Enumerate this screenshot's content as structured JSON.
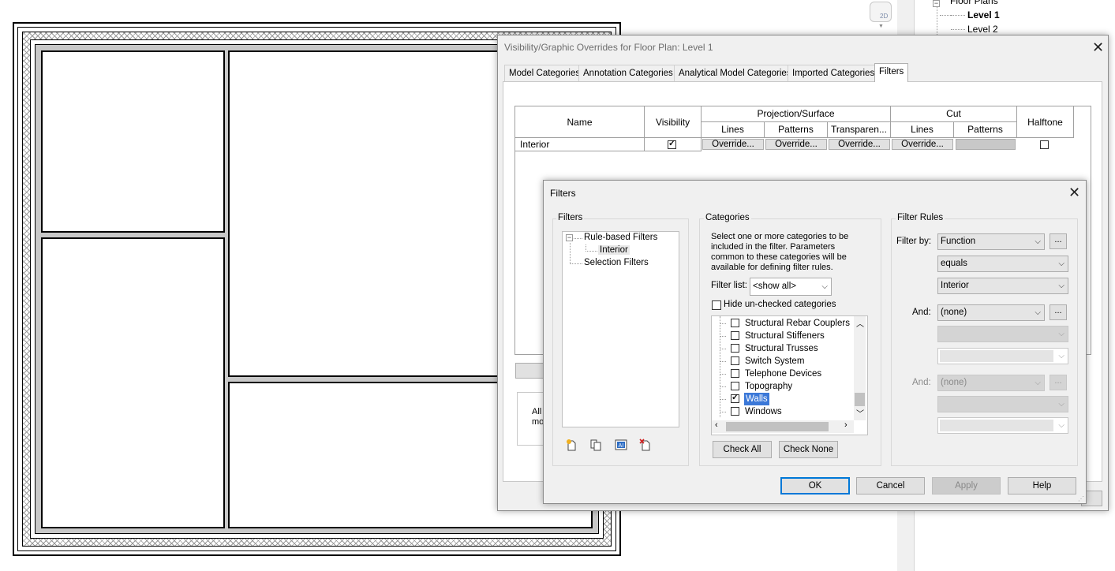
{
  "project_browser": {
    "floor_plans": "Floor Plans",
    "level1": "Level 1",
    "level2": "Level 2",
    "view_cube": "2D"
  },
  "vg_dialog": {
    "title": "Visibility/Graphic Overrides for Floor Plan: Level 1",
    "tabs": [
      "Model Categories",
      "Annotation Categories",
      "Analytical Model Categories",
      "Imported Categories",
      "Filters"
    ],
    "active_tab": "Filters",
    "headers": {
      "name": "Name",
      "visibility": "Visibility",
      "projection": "Projection/Surface",
      "cut": "Cut",
      "halftone": "Halftone",
      "lines": "Lines",
      "patterns": "Patterns",
      "transparency": "Transparen...",
      "cut_lines": "Lines",
      "cut_patterns": "Patterns"
    },
    "row": {
      "name": "Interior",
      "visible": true,
      "override": "Override...",
      "halftone": false
    },
    "partial_text": [
      "All",
      "mo"
    ]
  },
  "filters_dialog": {
    "title": "Filters",
    "filters_group": "Filters",
    "tree": {
      "rule_based": "Rule-based Filters",
      "interior": "Interior",
      "selection": "Selection Filters"
    },
    "categories_group": "Categories",
    "categories_desc": [
      "Select one or more categories to be",
      "included in the filter.  Parameters",
      "common to these categories will be",
      "available for defining filter rules."
    ],
    "filter_list_label": "Filter list:",
    "filter_list_value": "<show all>",
    "hide_unchecked": "Hide un-checked categories",
    "categories": [
      {
        "label": "Structural Rebar Couplers",
        "checked": false
      },
      {
        "label": "Structural Stiffeners",
        "checked": false
      },
      {
        "label": "Structural Trusses",
        "checked": false
      },
      {
        "label": "Switch System",
        "checked": false
      },
      {
        "label": "Telephone Devices",
        "checked": false
      },
      {
        "label": "Topography",
        "checked": false
      },
      {
        "label": "Walls",
        "checked": true,
        "selected": true
      },
      {
        "label": "Windows",
        "checked": false
      }
    ],
    "check_all": "Check All",
    "check_none": "Check None",
    "rules_group": "Filter Rules",
    "filter_by_label": "Filter by:",
    "filter_by": "Function",
    "operator": "equals",
    "value": "Interior",
    "and_label": "And:",
    "and1": "(none)",
    "and2": "(none)",
    "ellipsis": "...",
    "buttons": {
      "ok": "OK",
      "cancel": "Cancel",
      "apply": "Apply",
      "help": "Help"
    }
  }
}
